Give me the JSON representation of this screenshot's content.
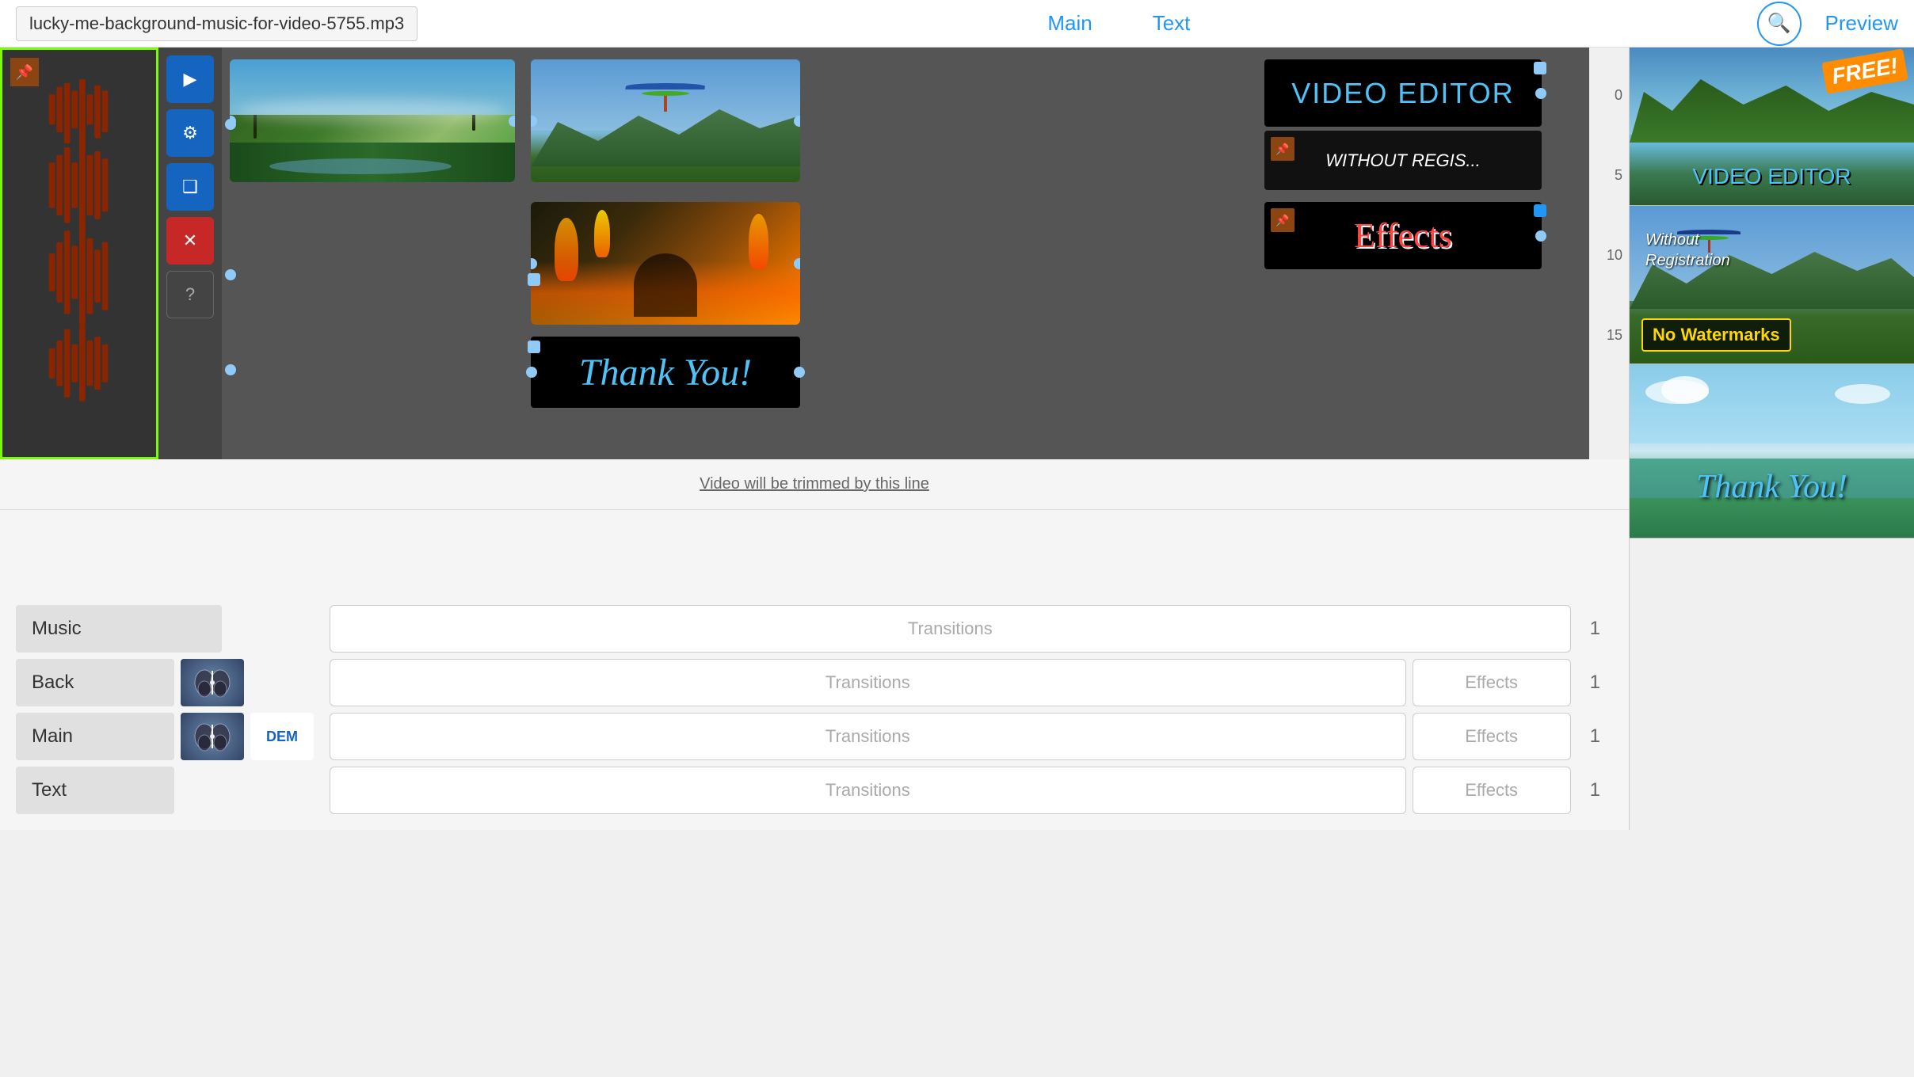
{
  "header": {
    "filename": "lucky-me-background-music-for-video-5755.mp3",
    "tab_main": "Main",
    "tab_text": "Text",
    "tab_preview": "Preview"
  },
  "toolbar": {
    "play_label": "▶",
    "settings_label": "⚙",
    "copy_label": "❑",
    "delete_label": "✕",
    "help_label": "?"
  },
  "timeline": {
    "trim_notice": "Video will be trimmed by this line",
    "numbers": [
      "0",
      "5",
      "10",
      "15"
    ]
  },
  "clips": [
    {
      "type": "video",
      "label": "landscape"
    },
    {
      "type": "video",
      "label": "hang-glider"
    },
    {
      "type": "text",
      "label": "VIDEO EDITOR"
    },
    {
      "type": "text",
      "label": "WITHOUT REGIS..."
    },
    {
      "type": "video",
      "label": "fire-couple"
    },
    {
      "type": "text",
      "label": "Effects"
    },
    {
      "type": "text",
      "label": "Thank You!"
    }
  ],
  "preview_panel": {
    "items": [
      {
        "id": "p1",
        "label": "VIDEO EDITOR - FREE"
      },
      {
        "id": "p2",
        "label": "Without Registration - No Watermarks"
      },
      {
        "id": "p3",
        "label": "Thank You!"
      }
    ]
  },
  "bottom_left": {
    "music_label": "Music",
    "back_label": "Back",
    "main_label": "Main",
    "text_label": "Text"
  },
  "bottom_center": {
    "transition_rows": [
      {
        "transitions_label": "Transitions",
        "effects_label": "",
        "number": "1"
      },
      {
        "transitions_label": "Transitions",
        "effects_label": "Effects",
        "number": "1"
      },
      {
        "transitions_label": "Transitions",
        "effects_label": "Effects",
        "number": "1"
      },
      {
        "transitions_label": "Transitions",
        "effects_label": "Effects",
        "number": "1"
      }
    ]
  }
}
